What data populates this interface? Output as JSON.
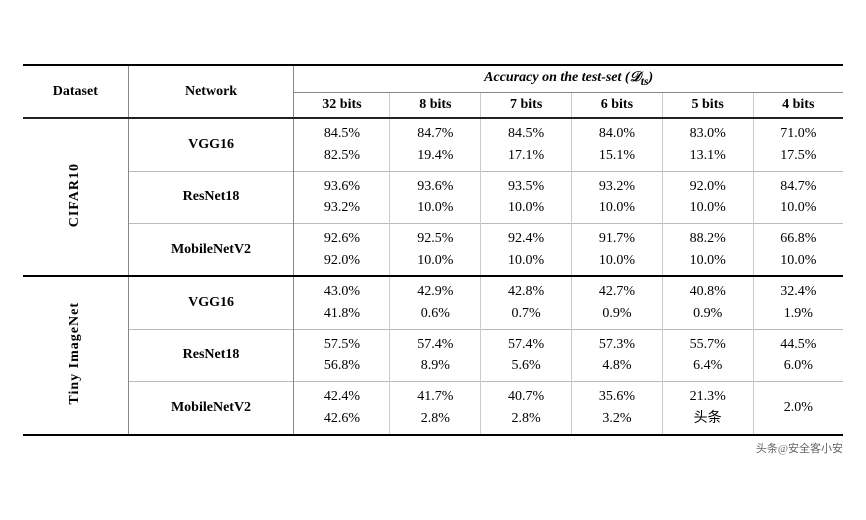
{
  "table": {
    "caption": "Accuracy on the test-set",
    "caption_formula": "(𝒟_ts)",
    "columns": {
      "dataset": "Dataset",
      "network": "Network",
      "bits": [
        "32 bits",
        "8 bits",
        "7 bits",
        "6 bits",
        "5 bits",
        "4 bits"
      ]
    },
    "sections": [
      {
        "dataset": "CIFAR10",
        "rows": [
          {
            "network": "VGG16",
            "values": [
              {
                "top": "84.5%",
                "bot": "82.5%"
              },
              {
                "top": "84.7%",
                "bot": "19.4%"
              },
              {
                "top": "84.5%",
                "bot": "17.1%"
              },
              {
                "top": "84.0%",
                "bot": "15.1%"
              },
              {
                "top": "83.0%",
                "bot": "13.1%"
              },
              {
                "top": "71.0%",
                "bot": "17.5%"
              }
            ]
          },
          {
            "network": "ResNet18",
            "values": [
              {
                "top": "93.6%",
                "bot": "93.2%"
              },
              {
                "top": "93.6%",
                "bot": "10.0%"
              },
              {
                "top": "93.5%",
                "bot": "10.0%"
              },
              {
                "top": "93.2%",
                "bot": "10.0%"
              },
              {
                "top": "92.0%",
                "bot": "10.0%"
              },
              {
                "top": "84.7%",
                "bot": "10.0%"
              }
            ]
          },
          {
            "network": "MobileNetV2",
            "values": [
              {
                "top": "92.6%",
                "bot": "92.0%"
              },
              {
                "top": "92.5%",
                "bot": "10.0%"
              },
              {
                "top": "92.4%",
                "bot": "10.0%"
              },
              {
                "top": "91.7%",
                "bot": "10.0%"
              },
              {
                "top": "88.2%",
                "bot": "10.0%"
              },
              {
                "top": "66.8%",
                "bot": "10.0%"
              }
            ]
          }
        ]
      },
      {
        "dataset": "Tiny ImageNet",
        "rows": [
          {
            "network": "VGG16",
            "values": [
              {
                "top": "43.0%",
                "bot": "41.8%"
              },
              {
                "top": "42.9%",
                "bot": "0.6%"
              },
              {
                "top": "42.8%",
                "bot": "0.7%"
              },
              {
                "top": "42.7%",
                "bot": "0.9%"
              },
              {
                "top": "40.8%",
                "bot": "0.9%"
              },
              {
                "top": "32.4%",
                "bot": "1.9%"
              }
            ]
          },
          {
            "network": "ResNet18",
            "values": [
              {
                "top": "57.5%",
                "bot": "56.8%"
              },
              {
                "top": "57.4%",
                "bot": "8.9%"
              },
              {
                "top": "57.4%",
                "bot": "5.6%"
              },
              {
                "top": "57.3%",
                "bot": "4.8%"
              },
              {
                "top": "55.7%",
                "bot": "6.4%"
              },
              {
                "top": "44.5%",
                "bot": "6.0%"
              }
            ]
          },
          {
            "network": "MobileNetV2",
            "values": [
              {
                "top": "42.4%",
                "bot": "42.6%"
              },
              {
                "top": "41.7%",
                "bot": "2.8%"
              },
              {
                "top": "40.7%",
                "bot": "2.8%"
              },
              {
                "top": "35.6%",
                "bot": "3.2%"
              },
              {
                "top": "21.3%",
                "bot": "头条"
              },
              {
                "top": "2.0%",
                "bot": ""
              }
            ]
          }
        ]
      }
    ],
    "watermark": "头条@安全客小安"
  }
}
